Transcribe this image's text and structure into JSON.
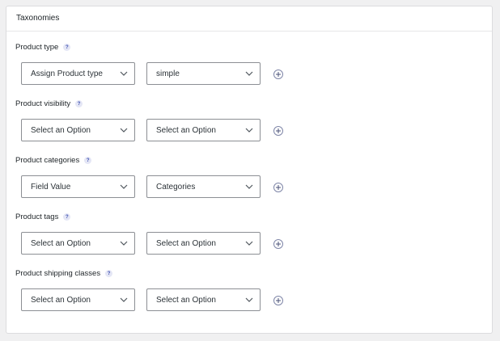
{
  "panel": {
    "title": "Taxonomies"
  },
  "help_glyph": "?",
  "rows": [
    {
      "label": "Product type",
      "select1": "Assign Product type",
      "select2": "simple"
    },
    {
      "label": "Product visibility",
      "select1": "Select an Option",
      "select2": "Select an Option"
    },
    {
      "label": "Product categories",
      "select1": "Field Value",
      "select2": "Categories"
    },
    {
      "label": "Product tags",
      "select1": "Select an Option",
      "select2": "Select an Option"
    },
    {
      "label": "Product shipping classes",
      "select1": "Select an Option",
      "select2": "Select an Option"
    }
  ],
  "colors": {
    "accent": "#3c4fb0",
    "border": "#8c8f94",
    "background": "#f0f0f1"
  },
  "icons": {
    "dropdown": "chevron-down-icon",
    "add": "plus-circle-icon",
    "help": "help-icon"
  }
}
